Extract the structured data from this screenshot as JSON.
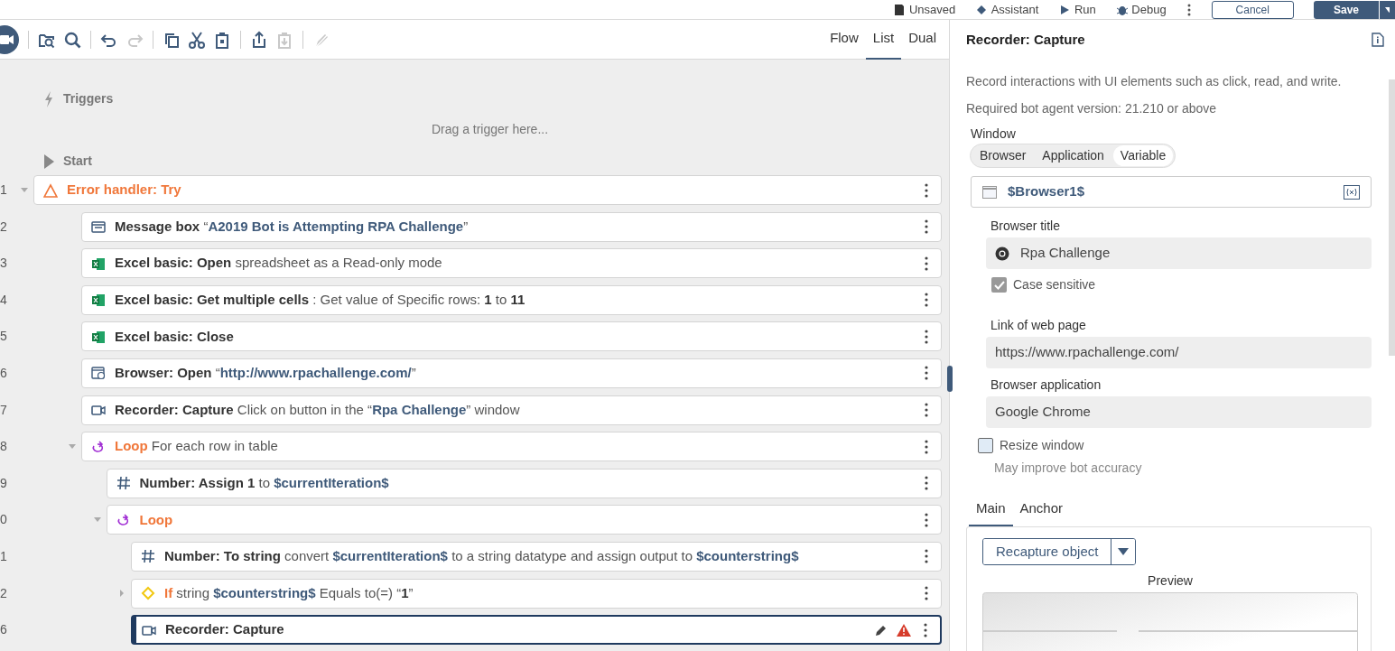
{
  "top_bar": {
    "items": [
      {
        "kind": "unsaved",
        "label": "Unsaved"
      },
      {
        "kind": "assistant",
        "label": "Assistant"
      },
      {
        "kind": "run",
        "label": "Run"
      },
      {
        "kind": "debug",
        "label": "Debug"
      }
    ],
    "cancel": "Cancel",
    "save": "Save"
  },
  "toolbar": {
    "tools": [
      {
        "kind": "record",
        "disabled": false
      },
      {
        "kind": "folder-search",
        "disabled": false
      },
      {
        "kind": "search",
        "disabled": false
      },
      {
        "kind": "undo",
        "disabled": false
      },
      {
        "kind": "redo",
        "disabled": true
      },
      {
        "kind": "copy",
        "disabled": false
      },
      {
        "kind": "cut",
        "disabled": false
      },
      {
        "kind": "paste",
        "disabled": false
      },
      {
        "kind": "export",
        "disabled": false
      },
      {
        "kind": "import",
        "disabled": true
      },
      {
        "kind": "disable",
        "disabled": true
      }
    ],
    "views": [
      {
        "label": "Flow",
        "selected": false
      },
      {
        "label": "List",
        "selected": true
      },
      {
        "label": "Dual",
        "selected": false
      }
    ]
  },
  "triggers": {
    "label": "Triggers",
    "hint": "Drag a trigger here..."
  },
  "start": {
    "label": "Start"
  },
  "steps": [
    {
      "line": "1",
      "kind": "error",
      "expanded": true,
      "selected": false,
      "warning": false,
      "text": [
        {
          "t": "Error handler: Try",
          "kind": "keyword"
        }
      ],
      "children": [
        {
          "line": "2",
          "kind": "message",
          "selected": false,
          "warning": false,
          "text": [
            {
              "t": "Message box",
              "kind": "action"
            },
            {
              "t": " “",
              "kind": "plain"
            },
            {
              "t": "A2019 Bot is Attempting RPA Challenge",
              "kind": "value"
            },
            {
              "t": "”",
              "kind": "plain"
            }
          ]
        },
        {
          "line": "3",
          "kind": "excel",
          "selected": false,
          "warning": false,
          "text": [
            {
              "t": "Excel basic: Open",
              "kind": "action"
            },
            {
              "t": " spreadsheet as a Read-only mode",
              "kind": "plain"
            }
          ]
        },
        {
          "line": "4",
          "kind": "excel",
          "selected": false,
          "warning": false,
          "text": [
            {
              "t": "Excel basic: Get multiple cells",
              "kind": "action"
            },
            {
              "t": " : Get value of Specific rows: ",
              "kind": "plain"
            },
            {
              "t": "1",
              "kind": "action"
            },
            {
              "t": " to ",
              "kind": "plain"
            },
            {
              "t": "11",
              "kind": "action"
            }
          ]
        },
        {
          "line": "5",
          "kind": "excel",
          "selected": false,
          "warning": false,
          "text": [
            {
              "t": "Excel basic: Close",
              "kind": "action"
            }
          ]
        },
        {
          "line": "6",
          "kind": "browser",
          "selected": false,
          "warning": false,
          "text": [
            {
              "t": "Browser: Open",
              "kind": "action"
            },
            {
              "t": " “",
              "kind": "plain"
            },
            {
              "t": "http://www.rpachallenge.com/",
              "kind": "value"
            },
            {
              "t": "”",
              "kind": "plain"
            }
          ]
        },
        {
          "line": "7",
          "kind": "recorder",
          "selected": false,
          "warning": false,
          "text": [
            {
              "t": "Recorder: Capture",
              "kind": "action"
            },
            {
              "t": " Click on button in the “",
              "kind": "plain"
            },
            {
              "t": "Rpa Challenge",
              "kind": "value"
            },
            {
              "t": "” window",
              "kind": "plain"
            }
          ]
        },
        {
          "line": "8",
          "kind": "loop",
          "expanded": true,
          "selected": false,
          "warning": false,
          "text": [
            {
              "t": "Loop",
              "kind": "keyword"
            },
            {
              "t": " For each row in table",
              "kind": "plain"
            }
          ],
          "children": [
            {
              "line": "9",
              "kind": "number",
              "selected": false,
              "warning": false,
              "text": [
                {
                  "t": "Number: Assign 1",
                  "kind": "action"
                },
                {
                  "t": " to ",
                  "kind": "plain"
                },
                {
                  "t": "$currentIteration$",
                  "kind": "value"
                }
              ]
            },
            {
              "line": "0",
              "kind": "loop",
              "expanded": true,
              "selected": false,
              "warning": false,
              "text": [
                {
                  "t": "Loop",
                  "kind": "keyword"
                }
              ],
              "children": [
                {
                  "line": "1",
                  "kind": "number",
                  "selected": false,
                  "warning": false,
                  "text": [
                    {
                      "t": "Number: To string",
                      "kind": "action"
                    },
                    {
                      "t": " convert ",
                      "kind": "plain"
                    },
                    {
                      "t": "$currentIteration$",
                      "kind": "value"
                    },
                    {
                      "t": " to a string datatype and assign output to ",
                      "kind": "plain"
                    },
                    {
                      "t": "$counterstring$",
                      "kind": "value"
                    }
                  ]
                },
                {
                  "line": "2",
                  "kind": "if",
                  "expanded": false,
                  "selected": false,
                  "warning": false,
                  "text": [
                    {
                      "t": "If",
                      "kind": "keyword"
                    },
                    {
                      "t": " string ",
                      "kind": "plain"
                    },
                    {
                      "t": "$counterstring$",
                      "kind": "value"
                    },
                    {
                      "t": " Equals to(=) “",
                      "kind": "plain"
                    },
                    {
                      "t": "1",
                      "kind": "action"
                    },
                    {
                      "t": "”",
                      "kind": "plain"
                    }
                  ]
                },
                {
                  "line": "6",
                  "kind": "recorder",
                  "selected": true,
                  "warning": true,
                  "text": [
                    {
                      "t": "Recorder: Capture",
                      "kind": "action"
                    }
                  ]
                }
              ]
            }
          ]
        }
      ]
    }
  ],
  "properties": {
    "title": "Recorder: Capture",
    "description": "Record interactions with UI elements such as click, read, and write.",
    "requirement": "Required bot agent version: 21.210 or above",
    "window_label": "Window",
    "window_options": [
      {
        "label": "Browser",
        "selected": false
      },
      {
        "label": "Application",
        "selected": false
      },
      {
        "label": "Variable",
        "selected": true
      }
    ],
    "variable": "$Browser1$",
    "browser_title": {
      "label": "Browser title",
      "value": "Rpa Challenge"
    },
    "case_sensitive": {
      "label": "Case sensitive",
      "checked": true
    },
    "link": {
      "label": "Link of web page",
      "value": "https://www.rpachallenge.com/"
    },
    "browser_application": {
      "label": "Browser application",
      "value": "Google Chrome"
    },
    "resize_window": {
      "label": "Resize window",
      "checked": false,
      "hint": "May improve bot accuracy"
    },
    "tabs": [
      {
        "label": "Main",
        "selected": true
      },
      {
        "label": "Anchor",
        "selected": false
      }
    ],
    "recapture_button": "Recapture object",
    "preview_label": "Preview"
  }
}
